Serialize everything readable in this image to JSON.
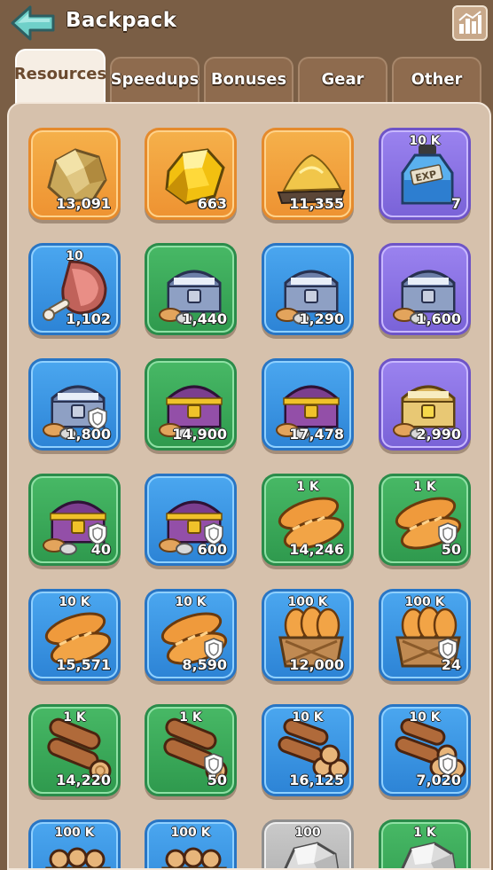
{
  "header": {
    "title": "Backpack"
  },
  "tabs": [
    {
      "label": "Resources",
      "active": true
    },
    {
      "label": "Speedups",
      "active": false
    },
    {
      "label": "Bonuses",
      "active": false
    },
    {
      "label": "Gear",
      "active": false
    },
    {
      "label": "Other",
      "active": false
    }
  ],
  "colors": {
    "background": "#7a5e45",
    "panel": "#d6c1ac",
    "orange": "#ee9332",
    "blue": "#2d84d6",
    "green": "#2f9a4e",
    "purple": "#7a63d8",
    "gray": "#a9a9a9"
  },
  "items": [
    {
      "icon": "gold-ore-icon",
      "rarity": "orange",
      "badge": "",
      "count": "13,091",
      "shield": false
    },
    {
      "icon": "gold-crystal-icon",
      "rarity": "orange",
      "badge": "",
      "count": "663",
      "shield": false
    },
    {
      "icon": "gold-dust-icon",
      "rarity": "orange",
      "badge": "",
      "count": "11,355",
      "shield": false
    },
    {
      "icon": "exp-potion-icon",
      "rarity": "purple",
      "badge": "10 K",
      "count": "7",
      "shield": false
    },
    {
      "icon": "meat-icon",
      "rarity": "blue",
      "badge": "10",
      "count": "1,102",
      "shield": false
    },
    {
      "icon": "iron-chest-icon",
      "rarity": "green",
      "badge": "",
      "count": "1,440",
      "shield": false
    },
    {
      "icon": "iron-chest-icon",
      "rarity": "blue",
      "badge": "",
      "count": "1,290",
      "shield": false
    },
    {
      "icon": "iron-chest-icon",
      "rarity": "purple",
      "badge": "",
      "count": "1,600",
      "shield": false
    },
    {
      "icon": "iron-chest-icon",
      "rarity": "blue",
      "badge": "",
      "count": "1,800",
      "shield": true
    },
    {
      "icon": "purple-gold-chest-icon",
      "rarity": "green",
      "badge": "",
      "count": "14,900",
      "shield": false
    },
    {
      "icon": "purple-gold-chest-icon",
      "rarity": "blue",
      "badge": "",
      "count": "17,478",
      "shield": false
    },
    {
      "icon": "gold-chest-icon",
      "rarity": "purple",
      "badge": "",
      "count": "2,990",
      "shield": false
    },
    {
      "icon": "purple-gold-chest-icon",
      "rarity": "green",
      "badge": "",
      "count": "40",
      "shield": true
    },
    {
      "icon": "purple-gold-chest-icon",
      "rarity": "blue",
      "badge": "",
      "count": "600",
      "shield": true
    },
    {
      "icon": "bread-icon",
      "rarity": "green",
      "badge": "1 K",
      "count": "14,246",
      "shield": false
    },
    {
      "icon": "bread-icon",
      "rarity": "green",
      "badge": "1 K",
      "count": "50",
      "shield": true
    },
    {
      "icon": "bread-icon",
      "rarity": "blue",
      "badge": "10 K",
      "count": "15,571",
      "shield": false
    },
    {
      "icon": "bread-icon",
      "rarity": "blue",
      "badge": "10 K",
      "count": "8,590",
      "shield": true
    },
    {
      "icon": "bread-crate-icon",
      "rarity": "blue",
      "badge": "100 K",
      "count": "12,000",
      "shield": false
    },
    {
      "icon": "bread-crate-icon",
      "rarity": "blue",
      "badge": "100 K",
      "count": "24",
      "shield": true
    },
    {
      "icon": "wood-logs-icon",
      "rarity": "green",
      "badge": "1 K",
      "count": "14,220",
      "shield": false
    },
    {
      "icon": "wood-logs-icon",
      "rarity": "green",
      "badge": "1 K",
      "count": "50",
      "shield": true
    },
    {
      "icon": "wood-pile-icon",
      "rarity": "blue",
      "badge": "10 K",
      "count": "16,125",
      "shield": false
    },
    {
      "icon": "wood-pile-icon",
      "rarity": "blue",
      "badge": "10 K",
      "count": "7,020",
      "shield": true
    },
    {
      "icon": "wood-crate-icon",
      "rarity": "blue",
      "badge": "100 K",
      "count": "",
      "shield": false
    },
    {
      "icon": "wood-crate-icon",
      "rarity": "blue",
      "badge": "100 K",
      "count": "",
      "shield": false
    },
    {
      "icon": "stone-icon",
      "rarity": "gray",
      "badge": "100",
      "count": "",
      "shield": false
    },
    {
      "icon": "stone-icon",
      "rarity": "green",
      "badge": "1 K",
      "count": "",
      "shield": false
    }
  ]
}
